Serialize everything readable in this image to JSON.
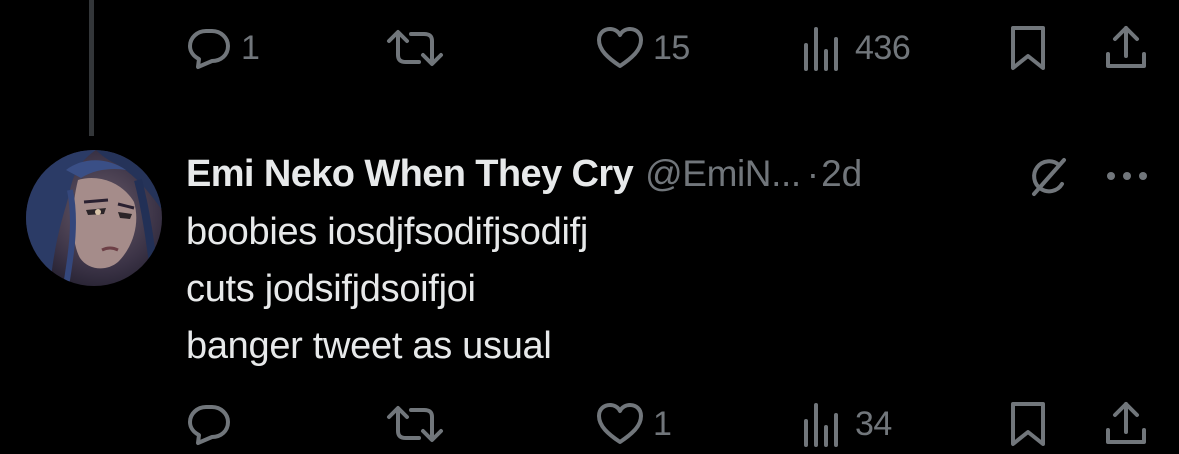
{
  "previous_tweet": {
    "actions": {
      "reply_count": "1",
      "retweet_count": "",
      "like_count": "15",
      "view_count": "436"
    },
    "icons": {
      "reply": "reply-icon",
      "retweet": "retweet-icon",
      "like": "heart-icon",
      "views": "views-icon",
      "bookmark": "bookmark-icon",
      "share": "share-icon"
    }
  },
  "reply_tweet": {
    "author": {
      "display_name": "Emi Neko When They Cry",
      "handle": "@EmiN...",
      "separator": "·",
      "time": "2d"
    },
    "body_lines": [
      "boobies iosdjfsodifjsodifj",
      "cuts jodsifjdsoifjoi",
      "banger tweet as usual"
    ],
    "actions": {
      "reply_count": "",
      "retweet_count": "",
      "like_count": "1",
      "view_count": "34"
    },
    "icons": {
      "grok": "grok-icon",
      "more": "more-icon"
    }
  },
  "colors": {
    "background": "#000000",
    "primary_text": "#e7e9ea",
    "secondary_text": "#71767b",
    "thread_line": "#333639"
  }
}
